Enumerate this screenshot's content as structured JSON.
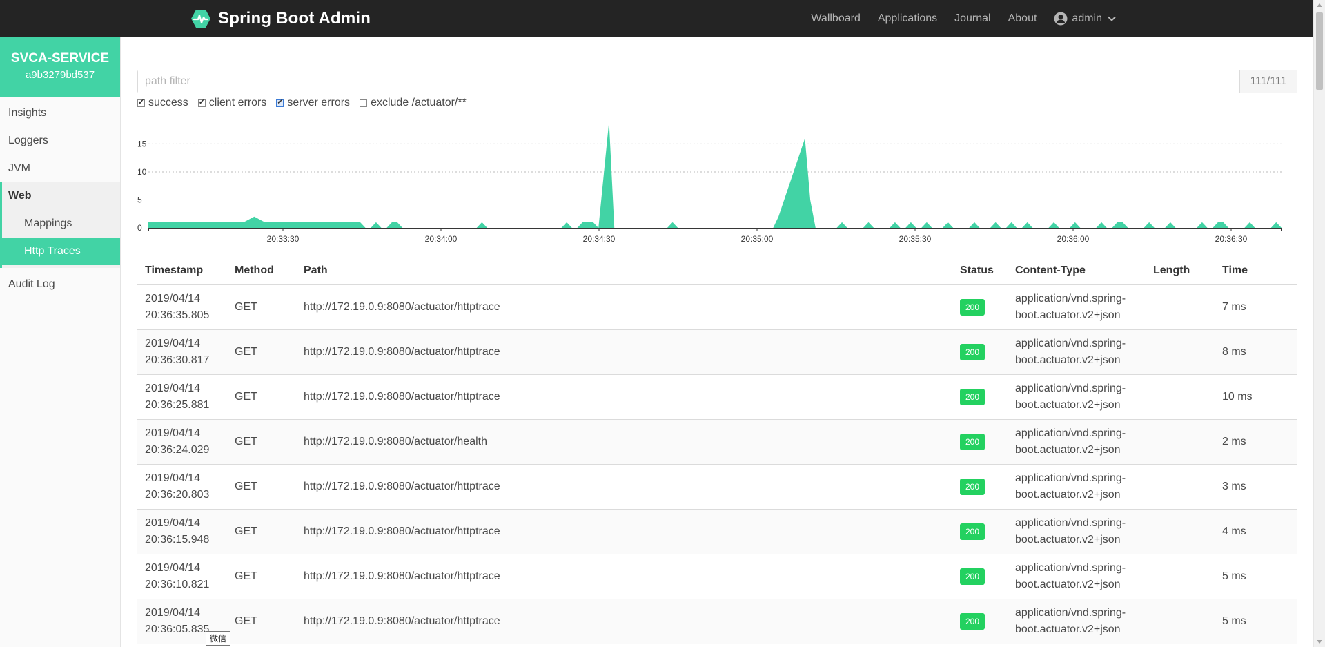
{
  "navbar": {
    "title": "Spring Boot Admin",
    "links": [
      "Wallboard",
      "Applications",
      "Journal",
      "About"
    ],
    "user": "admin"
  },
  "sidebar": {
    "instance_name": "SVCA-SERVICE",
    "instance_id": "a9b3279bd537",
    "items": [
      "Insights",
      "Loggers",
      "JVM",
      "Web"
    ],
    "sub_items": [
      "Mappings",
      "Http Traces"
    ],
    "audit": "Audit Log"
  },
  "filter": {
    "placeholder": "path filter",
    "count": "111/111"
  },
  "checkboxes": [
    {
      "label": "success",
      "checked": true
    },
    {
      "label": "client errors",
      "checked": true
    },
    {
      "label": "server errors",
      "checked": true
    },
    {
      "label": "exclude /actuator/**",
      "checked": false
    }
  ],
  "chart_data": {
    "type": "area",
    "x_ticks": [
      "20:33:30",
      "20:34:00",
      "20:34:30",
      "20:35:00",
      "20:35:30",
      "20:36:00",
      "20:36:30"
    ],
    "y_ticks": [
      0,
      5,
      10,
      15
    ],
    "ylim": [
      0,
      19
    ],
    "series_color": "#42d3a5",
    "series": [
      {
        "values": [
          [
            0,
            1
          ],
          [
            18,
            1
          ],
          [
            20,
            2
          ],
          [
            22,
            1
          ],
          [
            40,
            1
          ],
          [
            41,
            0
          ],
          [
            42,
            0
          ],
          [
            43,
            1
          ],
          [
            44,
            0
          ],
          [
            45,
            0
          ],
          [
            46,
            1
          ],
          [
            47,
            1
          ],
          [
            48,
            0
          ],
          [
            62,
            0
          ],
          [
            63,
            1
          ],
          [
            64,
            0
          ],
          [
            78,
            0
          ],
          [
            79,
            1
          ],
          [
            80,
            0
          ],
          [
            81,
            0
          ],
          [
            82,
            1
          ],
          [
            84,
            1
          ],
          [
            85,
            0
          ],
          [
            87,
            19
          ],
          [
            88,
            0
          ],
          [
            98,
            0
          ],
          [
            99,
            1
          ],
          [
            100,
            0
          ],
          [
            118,
            0
          ],
          [
            119,
            2
          ],
          [
            124,
            16
          ],
          [
            125,
            5
          ],
          [
            126,
            0
          ],
          [
            130,
            0
          ],
          [
            131,
            1
          ],
          [
            132,
            0
          ],
          [
            135,
            0
          ],
          [
            136,
            1
          ],
          [
            137,
            0
          ],
          [
            140,
            0
          ],
          [
            141,
            1
          ],
          [
            142,
            0
          ],
          [
            143,
            0
          ],
          [
            144,
            1
          ],
          [
            145,
            0
          ],
          [
            146,
            0
          ],
          [
            147,
            1
          ],
          [
            148,
            0
          ],
          [
            150,
            0
          ],
          [
            151,
            1
          ],
          [
            152,
            0
          ],
          [
            155,
            0
          ],
          [
            156,
            1
          ],
          [
            157,
            0
          ],
          [
            159,
            0
          ],
          [
            160,
            1
          ],
          [
            161,
            0
          ],
          [
            162,
            0
          ],
          [
            163,
            1
          ],
          [
            164,
            0
          ],
          [
            165,
            0
          ],
          [
            166,
            1
          ],
          [
            167,
            0
          ],
          [
            170,
            0
          ],
          [
            171,
            1
          ],
          [
            172,
            0
          ],
          [
            174,
            0
          ],
          [
            175,
            1
          ],
          [
            176,
            0
          ],
          [
            179,
            0
          ],
          [
            180,
            1
          ],
          [
            181,
            0
          ],
          [
            182,
            0
          ],
          [
            183,
            1
          ],
          [
            184,
            1
          ],
          [
            185,
            0
          ],
          [
            188,
            0
          ],
          [
            189,
            1
          ],
          [
            190,
            0
          ],
          [
            192,
            0
          ],
          [
            193,
            1
          ],
          [
            194,
            0
          ],
          [
            198,
            0
          ],
          [
            199,
            1
          ],
          [
            200,
            0
          ],
          [
            201,
            0
          ],
          [
            202,
            1
          ],
          [
            203,
            1
          ],
          [
            204,
            0
          ],
          [
            207,
            0
          ],
          [
            208,
            1
          ],
          [
            209,
            0
          ],
          [
            212,
            0
          ],
          [
            213,
            1
          ],
          [
            214,
            0
          ]
        ]
      }
    ]
  },
  "table": {
    "headers": [
      "Timestamp",
      "Method",
      "Path",
      "Status",
      "Content-Type",
      "Length",
      "Time"
    ],
    "rows": [
      {
        "date": "2019/04/14",
        "time": "20:36:35.805",
        "method": "GET",
        "path": "http://172.19.0.9:8080/actuator/httptrace",
        "status": "200",
        "ct1": "application/vnd.spring-",
        "ct2": "boot.actuator.v2+json",
        "length": "",
        "duration": "7 ms"
      },
      {
        "date": "2019/04/14",
        "time": "20:36:30.817",
        "method": "GET",
        "path": "http://172.19.0.9:8080/actuator/httptrace",
        "status": "200",
        "ct1": "application/vnd.spring-",
        "ct2": "boot.actuator.v2+json",
        "length": "",
        "duration": "8 ms"
      },
      {
        "date": "2019/04/14",
        "time": "20:36:25.881",
        "method": "GET",
        "path": "http://172.19.0.9:8080/actuator/httptrace",
        "status": "200",
        "ct1": "application/vnd.spring-",
        "ct2": "boot.actuator.v2+json",
        "length": "",
        "duration": "10 ms"
      },
      {
        "date": "2019/04/14",
        "time": "20:36:24.029",
        "method": "GET",
        "path": "http://172.19.0.9:8080/actuator/health",
        "status": "200",
        "ct1": "application/vnd.spring-",
        "ct2": "boot.actuator.v2+json",
        "length": "",
        "duration": "2 ms"
      },
      {
        "date": "2019/04/14",
        "time": "20:36:20.803",
        "method": "GET",
        "path": "http://172.19.0.9:8080/actuator/httptrace",
        "status": "200",
        "ct1": "application/vnd.spring-",
        "ct2": "boot.actuator.v2+json",
        "length": "",
        "duration": "3 ms"
      },
      {
        "date": "2019/04/14",
        "time": "20:36:15.948",
        "method": "GET",
        "path": "http://172.19.0.9:8080/actuator/httptrace",
        "status": "200",
        "ct1": "application/vnd.spring-",
        "ct2": "boot.actuator.v2+json",
        "length": "",
        "duration": "4 ms"
      },
      {
        "date": "2019/04/14",
        "time": "20:36:10.821",
        "method": "GET",
        "path": "http://172.19.0.9:8080/actuator/httptrace",
        "status": "200",
        "ct1": "application/vnd.spring-",
        "ct2": "boot.actuator.v2+json",
        "length": "",
        "duration": "5 ms"
      },
      {
        "date": "2019/04/14",
        "time": "20:36:05.835",
        "method": "GET",
        "path": "http://172.19.0.9:8080/actuator/httptrace",
        "status": "200",
        "ct1": "application/vnd.spring-",
        "ct2": "boot.actuator.v2+json",
        "length": "",
        "duration": "5 ms"
      }
    ]
  },
  "tooltip": "微信"
}
